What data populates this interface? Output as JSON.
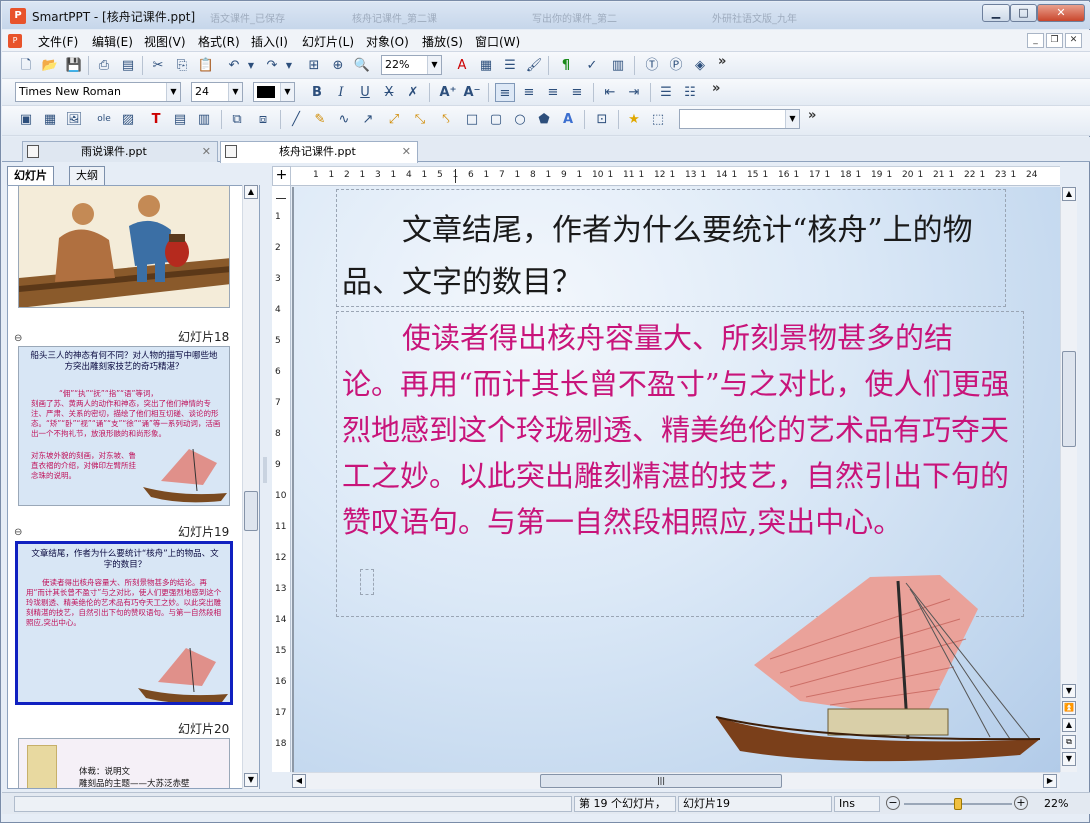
{
  "window": {
    "app_name": "SmartPPT",
    "title": "SmartPPT - [核舟记课件.ppt]"
  },
  "background_tabs": [
    "语文课件_已保存",
    "核舟记课件_第二课",
    "写出你的课件_第二",
    "外研社语文版_九年"
  ],
  "window_controls": {
    "minimize": "▁",
    "maximize": "□",
    "close": "✕"
  },
  "menu": [
    "文件(F)",
    "编辑(E)",
    "视图(V)",
    "格式(R)",
    "插入(I)",
    "幻灯片(L)",
    "对象(O)",
    "播放(S)",
    "窗口(W)"
  ],
  "mdi_controls": {
    "minimize": "_",
    "restore": "❐",
    "close": "✕"
  },
  "toolbar1": {
    "zoom": "22%",
    "more": "»"
  },
  "toolbar2": {
    "font_name": "Times New Roman",
    "font_size": "24",
    "more": "»"
  },
  "toolbar3": {
    "more": "»"
  },
  "doc_tabs": [
    {
      "label": "雨说课件.ppt",
      "close": "✕"
    },
    {
      "label": "核舟记课件.ppt",
      "close": "✕"
    }
  ],
  "left_tabs": {
    "slides": "幻灯片",
    "outline": "大纲"
  },
  "thumbnails": {
    "slide18": {
      "label": "幻灯片18",
      "title": "船头三人的神态有何不同？对人物的描写中哪些地方突出雕刻家技艺的奇巧精湛？",
      "line1": "“佣”“执”“抚”“指”“语”等词，",
      "line2": "刻画了苏、黄两人的动作和神态，突出了他们神情的专注、严肃、关系的密切，描绘了他们相互切磋、谈论的形态。“矫”“卧”“视”“诵”“支”“徐”“诵”等一系列动词，活画出一个不拘礼节，放浪形骸的和尚形象。",
      "line3": "对东坡外貌的刻画，对东坡、鲁直衣褶的介绍，对佛印左臂所挂念珠的说明。"
    },
    "slide19": {
      "label": "幻灯片19",
      "title": "文章结尾，作者为什么要统计“核舟”上的物品、文字的数目？",
      "body": "使读者得出核舟容量大、所刻景物甚多的结论。再用“而计其长曾不盈寸”与之对比，使人们更强烈地感到这个玲珑剔透、精美绝伦的艺术品有巧夺天工之妙。以此突出雕刻精湛的技艺，自然引出下句的赞叹语句。与第一自然段相照应,突出中心。"
    },
    "slide20": {
      "label": "幻灯片20",
      "line1": "体裁：说明文",
      "line2": "雕刻品的主题——大苏泛赤壁"
    }
  },
  "ruler_h": [
    "1",
    "1",
    "2",
    "1",
    "3",
    "1",
    "4",
    "1",
    "5",
    "1",
    "6",
    "1",
    "7",
    "1",
    "8",
    "1",
    "9",
    "1",
    "10",
    "1",
    "11",
    "1",
    "12",
    "1",
    "13",
    "1",
    "14",
    "1",
    "15",
    "1",
    "16",
    "1",
    "17",
    "1",
    "18",
    "1",
    "19",
    "1",
    "20",
    "1",
    "21",
    "1",
    "22",
    "1",
    "23",
    "1",
    "24"
  ],
  "ruler_v": [
    "1",
    "2",
    "3",
    "4",
    "5",
    "6",
    "7",
    "8",
    "9",
    "10",
    "11",
    "12",
    "13",
    "14",
    "15",
    "16",
    "17",
    "18"
  ],
  "slide": {
    "title": "文章结尾，作者为什么要统计“核舟”上的物品、文字的数目？",
    "body": "使读者得出核舟容量大、所刻景物甚多的结论。再用“而计其长曾不盈寸”与之对比，使人们更强烈地感到这个玲珑剔透、精美绝伦的艺术品有巧夺天工之妙。以此突出雕刻精湛的技艺，自然引出下句的赞叹语句。与第一自然段相照应,突出中心。"
  },
  "status": {
    "page": "第 19 个幻灯片，",
    "slide": "幻灯片19",
    "mode": "Ins",
    "zoom": "22%",
    "zoom_level": 0.22
  },
  "colors": {
    "body_text": "#c8147a",
    "title_text": "#1a1a1a",
    "selection": "#1020c0"
  }
}
